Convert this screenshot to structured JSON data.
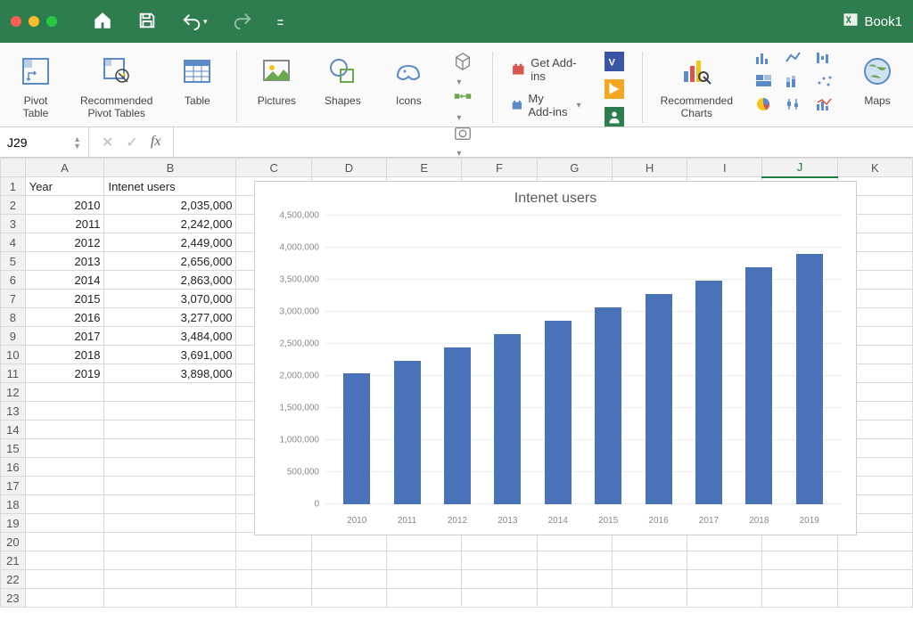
{
  "titlebar": {
    "book": "Book1"
  },
  "ribbon": {
    "pivot_table": "Pivot\nTable",
    "recommended_pivot": "Recommended\nPivot Tables",
    "table": "Table",
    "pictures": "Pictures",
    "shapes": "Shapes",
    "icons": "Icons",
    "get_addins": "Get Add-ins",
    "my_addins": "My Add-ins",
    "recommended_charts": "Recommended\nCharts",
    "maps": "Maps"
  },
  "formula_bar": {
    "name_box": "J29"
  },
  "columns": [
    "A",
    "B",
    "C",
    "D",
    "E",
    "F",
    "G",
    "H",
    "I",
    "J",
    "K"
  ],
  "active_column": "J",
  "row_count": 23,
  "data_headers": {
    "A": "Year",
    "B": "Intenet users"
  },
  "data_rows": [
    {
      "year": "2010",
      "users": "2,035,000"
    },
    {
      "year": "2011",
      "users": "2,242,000"
    },
    {
      "year": "2012",
      "users": "2,449,000"
    },
    {
      "year": "2013",
      "users": "2,656,000"
    },
    {
      "year": "2014",
      "users": "2,863,000"
    },
    {
      "year": "2015",
      "users": "3,070,000"
    },
    {
      "year": "2016",
      "users": "3,277,000"
    },
    {
      "year": "2017",
      "users": "3,484,000"
    },
    {
      "year": "2018",
      "users": "3,691,000"
    },
    {
      "year": "2019",
      "users": "3,898,000"
    }
  ],
  "chart_data": {
    "type": "bar",
    "title": "Intenet users",
    "categories": [
      "2010",
      "2011",
      "2012",
      "2013",
      "2014",
      "2015",
      "2016",
      "2017",
      "2018",
      "2019"
    ],
    "values": [
      2035000,
      2242000,
      2449000,
      2656000,
      2863000,
      3070000,
      3277000,
      3484000,
      3691000,
      3898000
    ],
    "ylim": [
      0,
      4500000
    ],
    "y_ticks": [
      0,
      500000,
      1000000,
      1500000,
      2000000,
      2500000,
      3000000,
      3500000,
      4000000,
      4500000
    ],
    "y_tick_labels": [
      "0",
      "500,000",
      "1,000,000",
      "1,500,000",
      "2,000,000",
      "2,500,000",
      "3,000,000",
      "3,500,000",
      "4,000,000",
      "4,500,000"
    ]
  }
}
